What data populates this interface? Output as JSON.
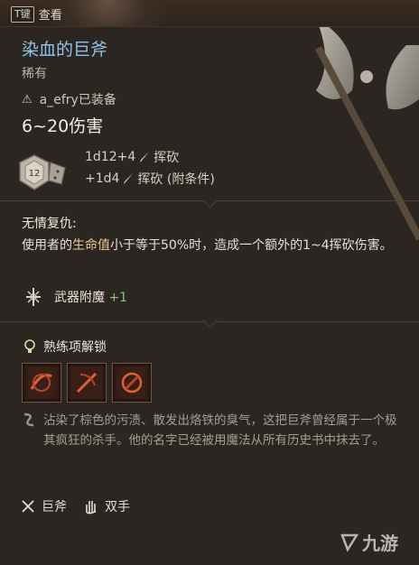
{
  "hint": {
    "key": "T键",
    "label": "查看"
  },
  "item": {
    "name": "染血的巨斧",
    "rarity": "稀有",
    "equipped_by": "a_efry已装备",
    "damage": "6~20伤害",
    "damage_lines": [
      {
        "dice": "1d12+4",
        "type": "挥砍"
      },
      {
        "dice": "+1d4",
        "type": "挥砍 (附条件)"
      }
    ],
    "die_face": "12",
    "passive": {
      "title": "无情复仇:",
      "desc_pre": "使用者的",
      "desc_hl": "生命值",
      "desc_post": "小于等于50%时，造成一个额外的1~4挥砍伤害。"
    },
    "enchant": {
      "label": "武器附魔",
      "value": "+1"
    },
    "proficiency": {
      "label": "熟练项解锁"
    },
    "flavor": "沾染了棕色的污渍、散发出烙铁的臭气，这把巨斧曾经属于一个极其疯狂的杀手。他的名字已经被用魔法从所有历史书中抹去了。",
    "tags": [
      {
        "icon": "greataxe-icon",
        "label": "巨斧"
      },
      {
        "icon": "two-handed-icon",
        "label": "双手"
      }
    ]
  },
  "watermark": "九游",
  "colors": {
    "title": "#8ec4e8",
    "highlight": "#e8c98f",
    "bonus": "#8dc27a"
  }
}
